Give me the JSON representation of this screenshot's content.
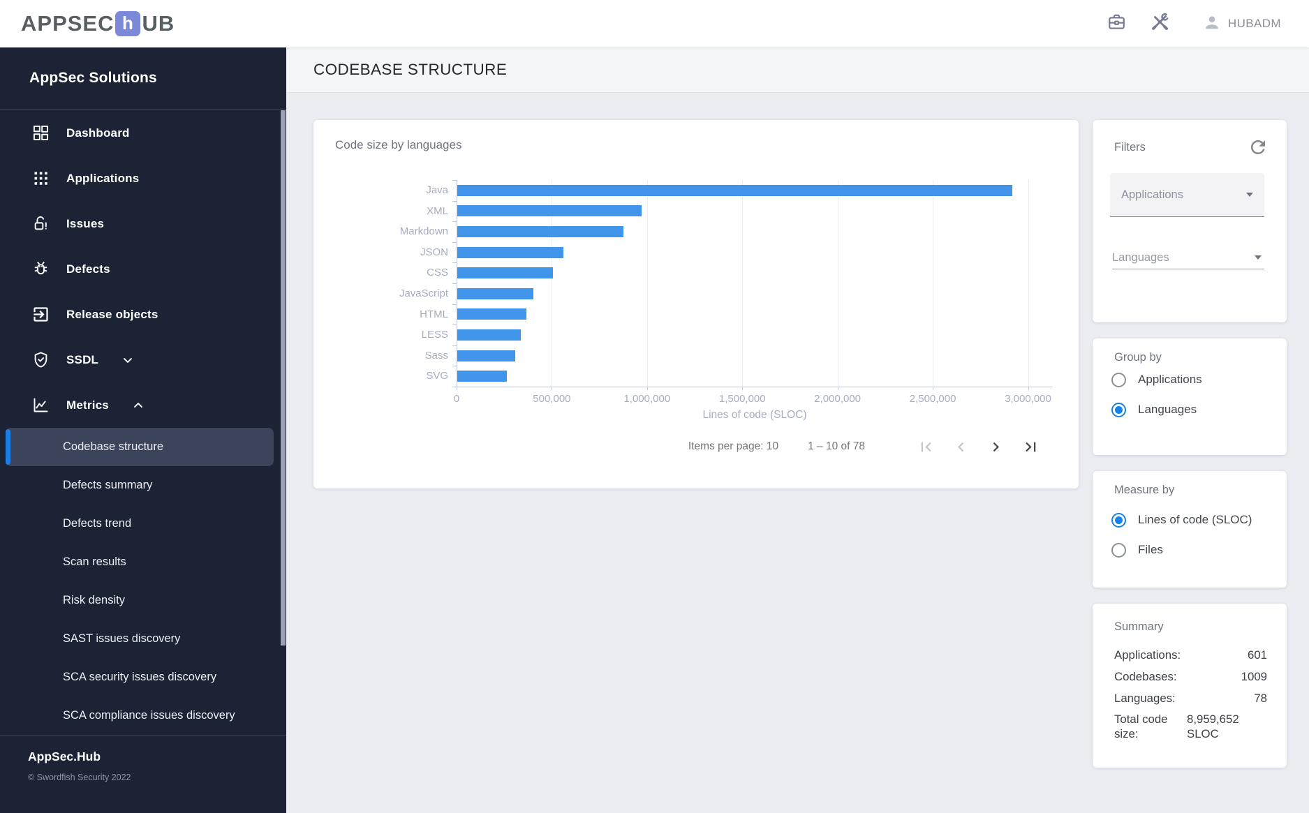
{
  "topbar": {
    "logo": {
      "prefix": "APPSEC",
      "accent": "h",
      "suffix": "UB",
      "accent_color": "#7c88d8"
    },
    "username": "HUBADM"
  },
  "sidebar": {
    "title": "AppSec Solutions",
    "items": [
      {
        "label": "Dashboard",
        "icon": "dashboard-icon"
      },
      {
        "label": "Applications",
        "icon": "apps-grid-icon"
      },
      {
        "label": "Issues",
        "icon": "lock-open-icon"
      },
      {
        "label": "Defects",
        "icon": "bug-icon"
      },
      {
        "label": "Release objects",
        "icon": "release-objects-icon"
      },
      {
        "label": "SSDL",
        "icon": "shield-check-icon",
        "chevron": "down"
      },
      {
        "label": "Metrics",
        "icon": "metrics-chart-icon",
        "chevron": "up"
      }
    ],
    "metrics_subitems": [
      {
        "label": "Codebase structure",
        "selected": true
      },
      {
        "label": "Defects summary",
        "selected": false
      },
      {
        "label": "Defects trend",
        "selected": false
      },
      {
        "label": "Scan results",
        "selected": false
      },
      {
        "label": "Risk density",
        "selected": false
      },
      {
        "label": "SAST issues discovery",
        "selected": false
      },
      {
        "label": "SCA security issues discovery",
        "selected": false
      },
      {
        "label": "SCA compliance issues discovery",
        "selected": false
      }
    ],
    "footer": {
      "brand": "AppSec.Hub",
      "copyright": "© Swordfish Security 2022"
    },
    "colors": {
      "bg": "#1c2334",
      "selected_bg": "#3c445c",
      "selected_accent": "#1d7fe3"
    }
  },
  "page": {
    "title": "CODEBASE STRUCTURE"
  },
  "chart_data": {
    "type": "bar",
    "orientation": "horizontal",
    "title": "Code size by languages",
    "categories": [
      "Java",
      "XML",
      "Markdown",
      "JSON",
      "CSS",
      "JavaScript",
      "HTML",
      "LESS",
      "Sass",
      "SVG"
    ],
    "values": [
      2912000,
      968000,
      873000,
      558000,
      502000,
      400000,
      363000,
      334000,
      305000,
      260000
    ],
    "xlabel": "Lines of code (SLOC)",
    "xlim": [
      0,
      3130000
    ],
    "ticks": {
      "values": [
        0,
        500000,
        1000000,
        1500000,
        2000000,
        2500000,
        3000000
      ],
      "labels": [
        "0",
        "500,000",
        "1,000,000",
        "1,500,000",
        "2,000,000",
        "2,500,000",
        "3,000,000"
      ]
    },
    "grid": true,
    "legend": false,
    "bar_color": "#4094ea",
    "grid_color": "#eaecf1",
    "axis_color": "#c5cad7"
  },
  "pagination": {
    "items_per_page_label": "Items per page:",
    "items_per_page": "10",
    "range_label": "1 – 10 of 78",
    "buttons": [
      {
        "icon": "first-page-icon",
        "disabled": true
      },
      {
        "icon": "chevron-left-icon",
        "disabled": true
      },
      {
        "icon": "chevron-right-icon",
        "disabled": false
      },
      {
        "icon": "last-page-icon",
        "disabled": false
      }
    ]
  },
  "filters": {
    "title": "Filters",
    "applications_label": "Applications",
    "languages_label": "Languages"
  },
  "group_by": {
    "title": "Group by",
    "options": [
      {
        "label": "Applications",
        "checked": false
      },
      {
        "label": "Languages",
        "checked": true
      }
    ]
  },
  "measure_by": {
    "title": "Measure by",
    "options": [
      {
        "label": "Lines of code (SLOC)",
        "checked": true
      },
      {
        "label": "Files",
        "checked": false
      }
    ]
  },
  "summary": {
    "title": "Summary",
    "rows": [
      {
        "label": "Applications:",
        "value": "601"
      },
      {
        "label": "Codebases:",
        "value": "1009"
      },
      {
        "label": "Languages:",
        "value": "78"
      }
    ],
    "total": {
      "label": "Total code size:",
      "value": "8,959,652 SLOC"
    }
  },
  "colors": {
    "accent_blue": "#1482e8",
    "bar_blue": "#4094ea"
  }
}
